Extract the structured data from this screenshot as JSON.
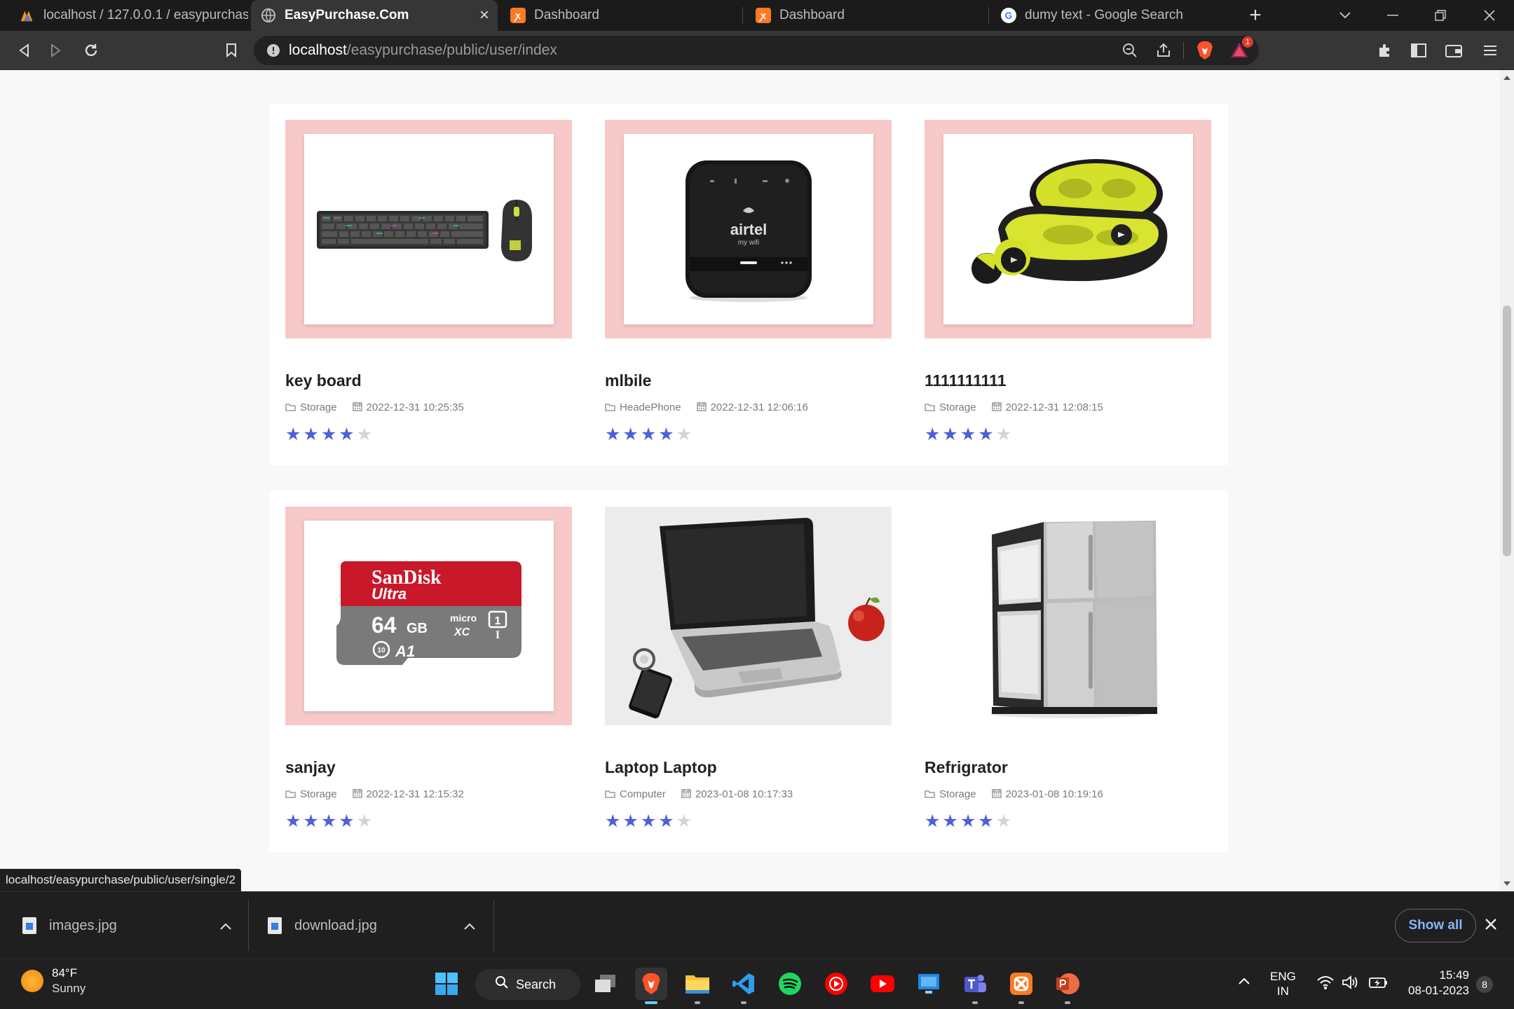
{
  "browser": {
    "tabs": [
      {
        "label": "localhost / 127.0.0.1 / easypurchase /",
        "icon": "phpmyadmin-icon"
      },
      {
        "label": "EasyPurchase.Com",
        "icon": "globe-icon",
        "active": true
      },
      {
        "label": "Dashboard",
        "icon": "xampp-icon"
      },
      {
        "label": "Dashboard",
        "icon": "xampp-icon"
      },
      {
        "label": "dumy text - Google Search",
        "icon": "google-icon"
      }
    ],
    "url_host": "localhost",
    "url_path": "/easypurchase/public/user/index",
    "brave_badge": "1"
  },
  "products": [
    {
      "title": "key board",
      "category": "Storage",
      "date": "2022-12-31 10:25:35",
      "rating": 4,
      "image": "keyboard-mouse-image"
    },
    {
      "title": "mlbile",
      "category": "HeadePhone",
      "date": "2022-12-31 12:06:16",
      "rating": 4,
      "image": "airtel-wifi-image"
    },
    {
      "title": "1111111111",
      "category": "Storage",
      "date": "2022-12-31 12:08:15",
      "rating": 4,
      "image": "earbuds-image"
    },
    {
      "title": "sanjay",
      "category": "Storage",
      "date": "2022-12-31 12:15:32",
      "rating": 4,
      "image": "sdcard-image"
    },
    {
      "title": "Laptop Laptop",
      "category": "Computer",
      "date": "2023-01-08 10:17:33",
      "rating": 4,
      "image": "laptop-image"
    },
    {
      "title": "Refrigrator",
      "category": "Storage",
      "date": "2023-01-08 10:19:16",
      "rating": 4,
      "image": "fridge-image"
    }
  ],
  "images": {
    "airtel": {
      "brand": "airtel",
      "sub": "my wifi"
    },
    "sdcard": {
      "brand": "SanDisk",
      "line": "Ultra",
      "capacity": "64",
      "unit": "GB",
      "standard": "micro",
      "xc": "XC",
      "uhs": "1",
      "class": "I",
      "app": "A1",
      "speed": "10"
    }
  },
  "status_link": "localhost/easypurchase/public/user/single/2",
  "downloads": {
    "items": [
      {
        "name": "images.jpg"
      },
      {
        "name": "download.jpg"
      }
    ],
    "show_all": "Show all"
  },
  "taskbar": {
    "weather_temp": "84°F",
    "weather_desc": "Sunny",
    "search_label": "Search",
    "lang_top": "ENG",
    "lang_bottom": "IN",
    "time": "15:49",
    "date": "08-01-2023",
    "notif_count": "8"
  },
  "colors": {
    "star_on": "#4b62d6",
    "star_off": "#d4d4d4",
    "thumb_bg": "#f7c9c9",
    "accent": "#60cdff"
  }
}
